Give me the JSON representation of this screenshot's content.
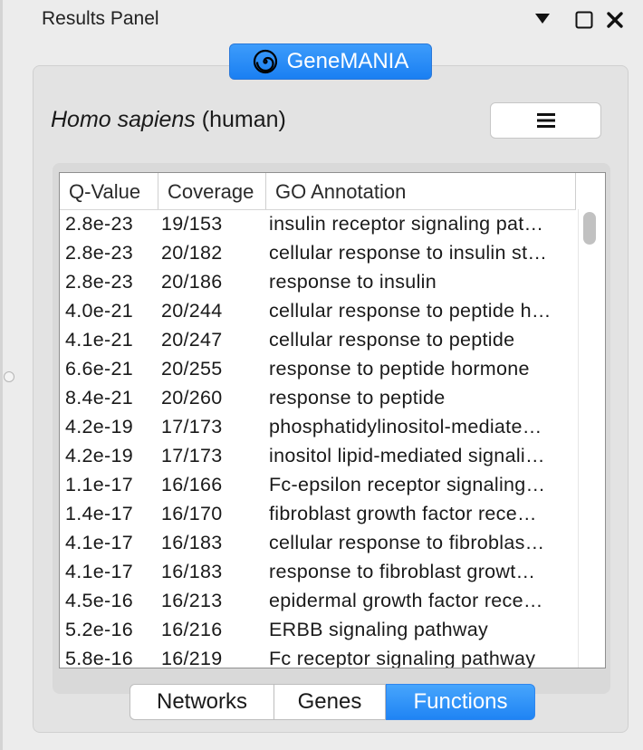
{
  "panel": {
    "title": "Results Panel",
    "icons": {
      "menu": "triangle-down-icon",
      "maximize": "square-icon",
      "close": "x-icon"
    }
  },
  "app_button": {
    "label": "GeneMANIA",
    "icon": "spiral-logo-icon",
    "color": "#1f84f4"
  },
  "organism": {
    "scientific": "Homo sapiens",
    "common": "(human)"
  },
  "options_button": {
    "icon": "hamburger-menu-icon"
  },
  "table": {
    "columns": [
      "Q-Value",
      "Coverage",
      "GO Annotation"
    ],
    "rows": [
      [
        "2.8e-23",
        "19/153",
        "insulin receptor signaling pat…"
      ],
      [
        "2.8e-23",
        "20/182",
        "cellular response to insulin st…"
      ],
      [
        "2.8e-23",
        "20/186",
        "response to insulin"
      ],
      [
        "4.0e-21",
        "20/244",
        "cellular response to peptide h…"
      ],
      [
        "4.1e-21",
        "20/247",
        "cellular response to peptide"
      ],
      [
        "6.6e-21",
        "20/255",
        "response to peptide hormone"
      ],
      [
        "8.4e-21",
        "20/260",
        "response to peptide"
      ],
      [
        "4.2e-19",
        "17/173",
        "phosphatidylinositol-mediate…"
      ],
      [
        "4.2e-19",
        "17/173",
        "inositol lipid-mediated signali…"
      ],
      [
        "1.1e-17",
        "16/166",
        "Fc-epsilon receptor signaling…"
      ],
      [
        "1.4e-17",
        "16/170",
        "fibroblast growth factor rece…"
      ],
      [
        "4.1e-17",
        "16/183",
        "cellular response to fibroblas…"
      ],
      [
        "4.1e-17",
        "16/183",
        "response to fibroblast growt…"
      ],
      [
        "4.5e-16",
        "16/213",
        "epidermal growth factor rece…"
      ],
      [
        "5.2e-16",
        "16/216",
        "ERBB signaling pathway"
      ],
      [
        "5.8e-16",
        "16/219",
        "Fc receptor signaling pathway"
      ]
    ]
  },
  "tabs": [
    {
      "label": "Networks",
      "selected": false
    },
    {
      "label": "Genes",
      "selected": false
    },
    {
      "label": "Functions",
      "selected": true
    }
  ],
  "colors": {
    "accent": "#1f84f4",
    "background": "#ececec"
  }
}
